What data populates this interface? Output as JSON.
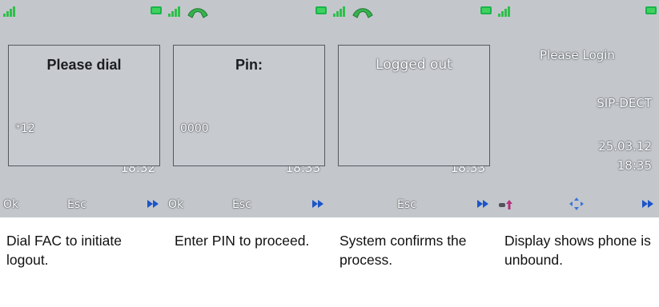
{
  "screens": [
    {
      "dialog_title": "Please dial",
      "dialog_value": "*12",
      "clock_partial": "18:32",
      "softkeys": {
        "left": "Ok",
        "middle": "Esc"
      },
      "icons": [
        "signal-icon",
        "battery-icon",
        "next-icon"
      ]
    },
    {
      "dialog_title": "Pin:",
      "dialog_value": "0000",
      "clock_partial": "18:33",
      "softkeys": {
        "left": "Ok",
        "middle": "Esc"
      },
      "icons": [
        "signal-icon",
        "handset-icon",
        "battery-icon",
        "next-icon"
      ]
    },
    {
      "dialog_title": "Logged out",
      "clock_partial": "18:33",
      "softkeys": {
        "middle": "Esc"
      },
      "icons": [
        "signal-icon",
        "handset-icon",
        "battery-icon",
        "next-icon"
      ]
    },
    {
      "title": "Please Login",
      "system": "SIP-DECT",
      "date": "25.03.12",
      "time": "18:35",
      "icons": [
        "signal-icon",
        "battery-icon",
        "key-icon",
        "nav-icon",
        "next-icon"
      ]
    }
  ],
  "captions": [
    "Dial FAC to initiate logout.",
    "Enter PIN to proceed.",
    "System confirms the process.",
    "Display shows phone is unbound."
  ],
  "colors": {
    "screen_bg": "#c3c7cc",
    "signal_green": "#2fbf4a",
    "arrow_blue": "#1c55c8"
  }
}
